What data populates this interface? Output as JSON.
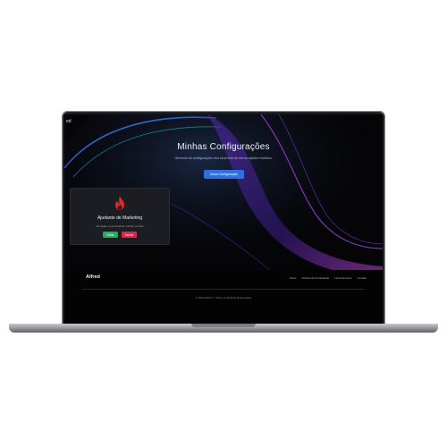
{
  "header": {
    "corner_text": "ed"
  },
  "hero": {
    "title": "Minhas Configurações",
    "subtitle": "Gerencie as configurações dos seus bots de forma rápida e intuitiva.",
    "new_button": "Nova Configuração"
  },
  "card": {
    "icon": "flame-icon",
    "title": "Ajudante de Marketing",
    "description": "Me ajude a personalizar minhas vendas",
    "edit_label": "Editar",
    "delete_label": "Excluir"
  },
  "footer": {
    "brand": "Alfred",
    "links": [
      "Sobre",
      "Política de Privacidade",
      "Licenciamento",
      "Contato"
    ],
    "copyright": "© 2023 Alfred™. Todos os Direitos Reservados."
  },
  "colors": {
    "accent_blue": "#2f6fe0",
    "edit_green": "#1fae5b",
    "delete_red": "#e0244e",
    "flame_red": "#e3262e"
  }
}
